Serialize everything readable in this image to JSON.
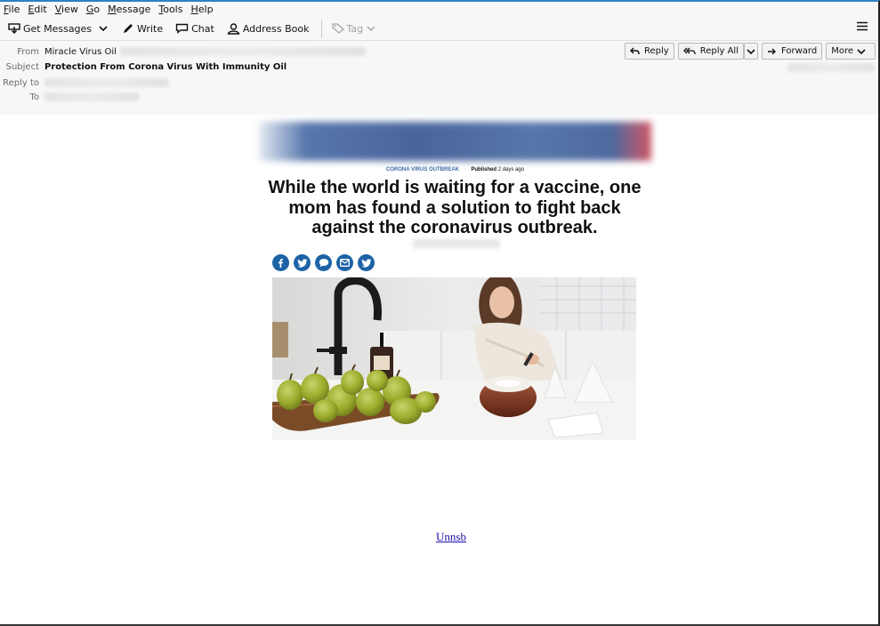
{
  "menu": [
    "File",
    "Edit",
    "View",
    "Go",
    "Message",
    "Tools",
    "Help"
  ],
  "toolbar": {
    "get_messages": "Get Messages",
    "write": "Write",
    "chat": "Chat",
    "address_book": "Address Book",
    "tag": "Tag"
  },
  "header": {
    "from_label": "From",
    "from_name": "Miracle Virus Oil",
    "subject_label": "Subject",
    "subject": "Protection From Corona Virus With Immunity Oil",
    "reply_to_label": "Reply to",
    "to_label": "To",
    "actions": {
      "reply": "Reply",
      "reply_all": "Reply All",
      "forward": "Forward",
      "more": "More"
    }
  },
  "article": {
    "category": "CORONA VIRUS OUTBREAK",
    "separator": "·",
    "published_label": "Published",
    "published_when": "2 days ago",
    "headline": "While the world is waiting for a vaccine, one mom has found a solution to fight back against the coronavirus outbreak.",
    "share_icons": [
      "facebook-icon",
      "twitter-icon",
      "comment-icon",
      "email-icon",
      "twitter-icon"
    ]
  },
  "footer": {
    "unsubscribe": "Unnsb"
  },
  "colors": {
    "accent": "#2f7fc4",
    "share": "#1d63a6",
    "category": "#3d6aa6",
    "link": "#1a0dab"
  }
}
